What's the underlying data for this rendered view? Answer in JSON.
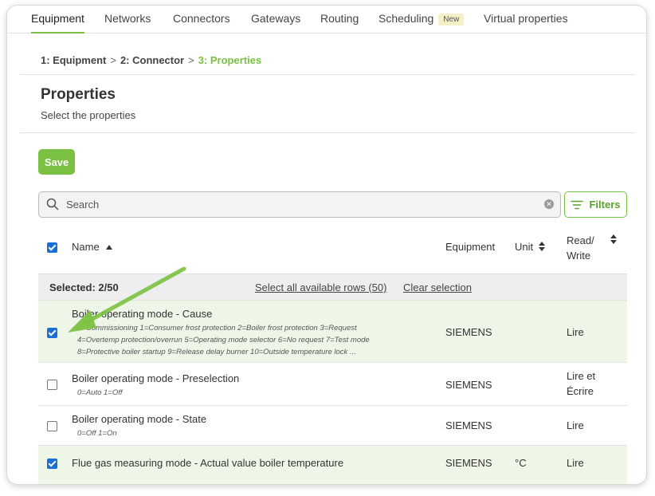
{
  "tabs": [
    {
      "label": "Equipment"
    },
    {
      "label": "Networks"
    },
    {
      "label": "Connectors"
    },
    {
      "label": "Gateways"
    },
    {
      "label": "Routing"
    },
    {
      "label": "Scheduling",
      "badge": "New"
    },
    {
      "label": "Virtual properties"
    }
  ],
  "breadcrumb": {
    "step1": "1:  Equipment",
    "sep": ">",
    "step2": "2:  Connector",
    "step3": "3:  Properties"
  },
  "page": {
    "title": "Properties",
    "subtitle": "Select the properties"
  },
  "toolbar": {
    "save_label": "Save",
    "search_placeholder": "Search",
    "filters_label": "Filters"
  },
  "table": {
    "columns": {
      "name": "Name",
      "equipment": "Equipment",
      "unit": "Unit",
      "rw_line1": "Read/",
      "rw_line2": "Write"
    },
    "selection": {
      "count": "Selected: 2/50",
      "select_all": "Select all available rows (50)",
      "clear": "Clear selection"
    },
    "rows": [
      {
        "checked": true,
        "name": "Boiler operating mode - Cause",
        "desc": [
          "0=Commissioning 1=Consumer frost protection 2=Boiler frost protection 3=Request",
          "4=Overtemp protection/overrun 5=Operating mode selector 6=No request 7=Test mode",
          "8=Protective boiler startup 9=Release delay burner 10=Outside temperature lock ..."
        ],
        "equipment": "SIEMENS",
        "unit": "",
        "rw": [
          "Lire"
        ]
      },
      {
        "checked": false,
        "name": "Boiler operating mode - Preselection",
        "desc": [
          "0=Auto 1=Off"
        ],
        "equipment": "SIEMENS",
        "unit": "",
        "rw": [
          "Lire et",
          "Écrire"
        ]
      },
      {
        "checked": false,
        "name": "Boiler operating mode - State",
        "desc": [
          "0=Off 1=On"
        ],
        "equipment": "SIEMENS",
        "unit": "",
        "rw": [
          "Lire"
        ]
      },
      {
        "checked": true,
        "name": "Flue gas measuring mode - Actual value boiler temperature",
        "desc": [],
        "equipment": "SIEMENS",
        "unit": "°C",
        "rw": [
          "Lire"
        ]
      }
    ]
  },
  "colors": {
    "accent": "#7ac143",
    "checkbox": "#1a6fd6",
    "selected_row": "#eef6e8"
  },
  "icons": [
    "search-icon",
    "clear-search-icon",
    "filter-icon",
    "sort-up-icon",
    "sort-updown-icon",
    "pointer-arrow"
  ]
}
